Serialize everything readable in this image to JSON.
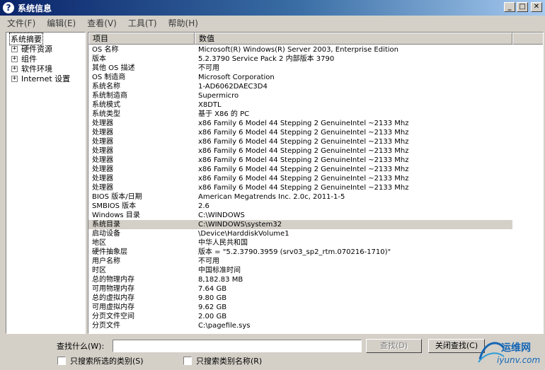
{
  "window": {
    "title": "系统信息",
    "buttons": [
      "_",
      "□",
      "✕"
    ]
  },
  "menu": [
    "文件(F)",
    "编辑(E)",
    "查看(V)",
    "工具(T)",
    "帮助(H)"
  ],
  "tree": [
    {
      "label": "系统摘要",
      "selected": true,
      "expander": ""
    },
    {
      "label": "硬件资源",
      "selected": false,
      "expander": "+"
    },
    {
      "label": "组件",
      "selected": false,
      "expander": "+"
    },
    {
      "label": "软件环境",
      "selected": false,
      "expander": "+"
    },
    {
      "label": "Internet 设置",
      "selected": false,
      "expander": "+"
    }
  ],
  "table": {
    "headers": {
      "item": "项目",
      "value": "数值"
    },
    "rows": [
      {
        "item": "OS 名称",
        "value": "Microsoft(R) Windows(R) Server 2003, Enterprise Edition"
      },
      {
        "item": "版本",
        "value": "5.2.3790 Service Pack 2 内部版本 3790"
      },
      {
        "item": "其他 OS 描述",
        "value": "不可用"
      },
      {
        "item": "OS 制造商",
        "value": "Microsoft Corporation"
      },
      {
        "item": "系统名称",
        "value": "1-AD6062DAEC3D4"
      },
      {
        "item": "系统制造商",
        "value": "Supermicro"
      },
      {
        "item": "系统模式",
        "value": "X8DTL"
      },
      {
        "item": "系统类型",
        "value": "基于 X86 的 PC"
      },
      {
        "item": "处理器",
        "value": "x86 Family 6 Model 44 Stepping 2 GenuineIntel ~2133 Mhz"
      },
      {
        "item": "处理器",
        "value": "x86 Family 6 Model 44 Stepping 2 GenuineIntel ~2133 Mhz"
      },
      {
        "item": "处理器",
        "value": "x86 Family 6 Model 44 Stepping 2 GenuineIntel ~2133 Mhz"
      },
      {
        "item": "处理器",
        "value": "x86 Family 6 Model 44 Stepping 2 GenuineIntel ~2133 Mhz"
      },
      {
        "item": "处理器",
        "value": "x86 Family 6 Model 44 Stepping 2 GenuineIntel ~2133 Mhz"
      },
      {
        "item": "处理器",
        "value": "x86 Family 6 Model 44 Stepping 2 GenuineIntel ~2133 Mhz"
      },
      {
        "item": "处理器",
        "value": "x86 Family 6 Model 44 Stepping 2 GenuineIntel ~2133 Mhz"
      },
      {
        "item": "处理器",
        "value": "x86 Family 6 Model 44 Stepping 2 GenuineIntel ~2133 Mhz"
      },
      {
        "item": "BIOS 版本/日期",
        "value": "American Megatrends Inc. 2.0c, 2011-1-5"
      },
      {
        "item": "SMBIOS 版本",
        "value": "2.6"
      },
      {
        "item": "Windows 目录",
        "value": "C:\\WINDOWS"
      },
      {
        "item": "系统目录",
        "value": "C:\\WINDOWS\\system32",
        "selected": true
      },
      {
        "item": "启动设备",
        "value": "\\Device\\HarddiskVolume1"
      },
      {
        "item": "地区",
        "value": "中华人民共和国"
      },
      {
        "item": "硬件抽象层",
        "value": "版本 = \"5.2.3790.3959 (srv03_sp2_rtm.070216-1710)\""
      },
      {
        "item": "用户名称",
        "value": "不可用"
      },
      {
        "item": "时区",
        "value": "中国标准时间"
      },
      {
        "item": "总的物理内存",
        "value": "8,182.83 MB"
      },
      {
        "item": "可用物理内存",
        "value": "7.64 GB"
      },
      {
        "item": "总的虚拟内存",
        "value": "9.80 GB"
      },
      {
        "item": "可用虚拟内存",
        "value": "9.62 GB"
      },
      {
        "item": "分页文件空间",
        "value": "2.00 GB"
      },
      {
        "item": "分页文件",
        "value": "C:\\pagefile.sys"
      }
    ]
  },
  "find": {
    "label": "查找什么(W):",
    "input_value": "",
    "find_button": "查找(D)",
    "close_button": "关闭查找(C)",
    "checkbox1": "只搜索所选的类别(S)",
    "checkbox2": "只搜索类别名称(R)"
  },
  "watermark": {
    "main": "运维网",
    "sub": "iyunv.com"
  },
  "colors": {
    "title_start": "#0a246a",
    "title_end": "#a6caf0",
    "face": "#d4d0c8",
    "watermark": "#1566b5"
  }
}
